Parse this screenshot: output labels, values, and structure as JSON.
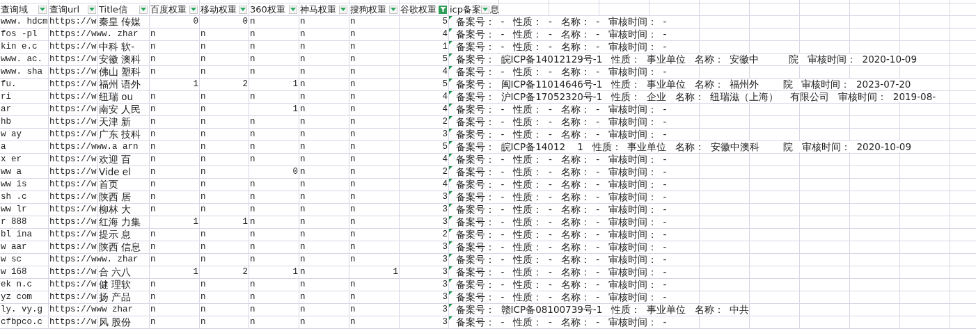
{
  "columns": [
    {
      "label": "查询域",
      "filter_active": false
    },
    {
      "label": "查询url",
      "filter_active": false
    },
    {
      "label": "Title信",
      "filter_active": false
    },
    {
      "label": "百度权重",
      "filter_active": false
    },
    {
      "label": "移动权重",
      "filter_active": false
    },
    {
      "label": "360权重",
      "filter_active": false
    },
    {
      "label": "神马权重",
      "filter_active": false
    },
    {
      "label": "搜狗权重",
      "filter_active": false
    },
    {
      "label": "谷歌权重",
      "filter_active": true
    },
    {
      "label": "icp备案",
      "label_tail": "息",
      "filter_active": false
    }
  ],
  "rows": [
    {
      "domain": "www. hdcm",
      "url": "https://w",
      "title": "秦皇 传媒",
      "baidu": "0",
      "mobile": "0",
      "r360": "n",
      "shenma": "n",
      "sogou": "n",
      "google": "5",
      "icp": "备案号：  -   性质：  -   名称：  -   审核时间：  -",
      "error_flag": true
    },
    {
      "domain": "fos -pl",
      "url": "https://www. zhar",
      "baidu": "n",
      "mobile": "n",
      "r360": "n",
      "shenma": "n",
      "sogou": "n",
      "google": "4",
      "icp": "备案号：  -   性质：  -   名称：  -   审核时间：  -",
      "error_flag": true
    },
    {
      "domain": "kin e.c",
      "url": "https://w",
      "title": "中科 软-",
      "baidu": "n",
      "mobile": "n",
      "r360": "n",
      "shenma": "n",
      "sogou": "n",
      "google": "1",
      "icp": "备案号：  -   性质：  -   名称：  -   审核时间：  -",
      "error_flag": true
    },
    {
      "domain": "www. ac.",
      "url": "https://w",
      "title": "安徽 澳科",
      "baidu": "n",
      "mobile": "n",
      "r360": "n",
      "shenma": "n",
      "sogou": "n",
      "google": "5",
      "icp": "备案号：  皖ICP备14012129号-1   性质：  事业单位   名称：  安徽中          院   审核时间：  2020-10-09",
      "error_flag": true
    },
    {
      "domain": "www. sha",
      "url": "https://w",
      "title": "佛山 塑科",
      "baidu": "n",
      "mobile": "n",
      "r360": "n",
      "shenma": "n",
      "sogou": "n",
      "google": "4",
      "icp": "备案号：  -   性质：  -   名称：  -   审核时间：  -",
      "error_flag": true
    },
    {
      "domain": "fu.",
      "url": "https://w",
      "title": "福州 语外",
      "baidu": "1",
      "mobile": "2",
      "r360": "1",
      "shenma": "n",
      "sogou": "n",
      "google": "5",
      "icp": "备案号：  闽ICP备11014646号-1   性质：  事业单位   名称：  福州外        院   审核时间：  2023-07-20",
      "error_flag": true
    },
    {
      "domain": "ri",
      "url": "https://w",
      "title": "纽瑞 ou",
      "baidu": "n",
      "mobile": "n",
      "r360": "n",
      "shenma": "n",
      "sogou": "n",
      "google": "4",
      "icp": "备案号：  沪ICP备17052320号-1   性质：  企业   名称：  纽瑞滋（上海）    有限公司   审核时间：  2019-08-",
      "error_flag": true
    },
    {
      "domain": "ar",
      "url": "https://w",
      "title": "南安 人民",
      "baidu": "n",
      "mobile": "n",
      "r360": "1",
      "shenma": "n",
      "sogou": "n",
      "google": "4",
      "icp": "备案号：  -   性质：  -   名称：  -   审核时间：  -",
      "error_flag": true
    },
    {
      "domain": "hb",
      "url": "https://w",
      "title": "天津 新",
      "baidu": "n",
      "mobile": "n",
      "r360": "n",
      "shenma": "n",
      "sogou": "n",
      "google": "2",
      "icp": "备案号：  -   性质：  -   名称：  -   审核时间：  -",
      "error_flag": true
    },
    {
      "domain": "w ay",
      "url": "https://w",
      "title": "广东 技科",
      "baidu": "n",
      "mobile": "n",
      "r360": "n",
      "shenma": "n",
      "sogou": "n",
      "google": "3",
      "icp": "备案号：  -   性质：  -   名称：  -   审核时间：  -",
      "error_flag": true
    },
    {
      "domain": "a",
      "url": "https://www.a arn",
      "baidu": "n",
      "mobile": "n",
      "r360": "n",
      "shenma": "n",
      "sogou": "n",
      "google": "5",
      "icp": "备案号：  皖ICP备14012    1   性质：  事业单位   名称：  安徽中澳科        院   审核时间：  2020-10-09",
      "error_flag": true
    },
    {
      "domain": "x er",
      "url": "https://w",
      "title": "欢迎 百",
      "baidu": "n",
      "mobile": "n",
      "r360": "n",
      "shenma": "n",
      "sogou": "n",
      "google": "4",
      "icp": "备案号：  -   性质：  -   名称：  -   审核时间：  -",
      "error_flag": true
    },
    {
      "domain": "ww a",
      "url": "https://w",
      "title": "Vide el",
      "baidu": "n",
      "mobile": "n",
      "r360": "0",
      "shenma": "n",
      "sogou": "n",
      "google": "2",
      "icp": "备案号：  -   性质：  -   名称：  -   审核时间：  -",
      "error_flag": true
    },
    {
      "domain": "ww is",
      "url": "https://w",
      "title": "首页",
      "baidu": "n",
      "mobile": "n",
      "r360": "n",
      "shenma": "n",
      "sogou": "n",
      "google": "4",
      "icp": "备案号：  -   性质：  -   名称：  -   审核时间：  -",
      "error_flag": true
    },
    {
      "domain": "sh .c",
      "url": "https://w",
      "title": "陕西 居",
      "baidu": "n",
      "mobile": "n",
      "r360": "n",
      "shenma": "n",
      "sogou": "n",
      "google": "3",
      "icp": "备案号：  -   性质：  -   名称：  -   审核时间：  -",
      "error_flag": true
    },
    {
      "domain": "ww lr",
      "url": "https://w",
      "title": "柳林 大",
      "baidu": "n",
      "mobile": "n",
      "r360": "n",
      "shenma": "n",
      "sogou": "n",
      "google": "3",
      "icp": "备案号：  -   性质：  -   名称：  -   审核时间：  -",
      "error_flag": true
    },
    {
      "domain": "r 888",
      "url": "https://w",
      "title": "红海 力集",
      "baidu": "1",
      "mobile": "1",
      "r360": "n",
      "shenma": "n",
      "sogou": "n",
      "google": "3",
      "icp": "备案号：  -   性质：  -   名称：  -   审核时间：  -",
      "error_flag": true
    },
    {
      "domain": "bl ina",
      "url": "https://w",
      "title": "提示 息",
      "baidu": "n",
      "mobile": "n",
      "r360": "n",
      "shenma": "n",
      "sogou": "n",
      "google": "2",
      "icp": "备案号：  -   性质：  -   名称：  -   审核时间：  -",
      "error_flag": true
    },
    {
      "domain": "w aar",
      "url": "https://w",
      "title": "陕西 信息",
      "baidu": "n",
      "mobile": "n",
      "r360": "n",
      "shenma": "n",
      "sogou": "n",
      "google": "3",
      "icp": "备案号：  -   性质：  -   名称：  -   审核时间：  -",
      "error_flag": true
    },
    {
      "domain": "w sc",
      "url": "https://www. zhar",
      "baidu": "n",
      "mobile": "n",
      "r360": "n",
      "shenma": "n",
      "sogou": "n",
      "google": "3",
      "icp": "备案号：  -   性质：  -   名称：  -   审核时间：  -",
      "error_flag": true
    },
    {
      "domain": "w 168",
      "url": "https://w",
      "title": "合 六八",
      "baidu": "1",
      "mobile": "2",
      "r360": "1",
      "shenma": "n",
      "sogou": "1",
      "google": "3",
      "icp": "备案号：  -   性质：  -   名称：  -   审核时间：  -",
      "error_flag": true
    },
    {
      "domain": "ek n.c",
      "url": "https://w",
      "title": "健 理软",
      "baidu": "n",
      "mobile": "n",
      "r360": "n",
      "shenma": "n",
      "sogou": "n",
      "google": "3",
      "icp": "备案号：  -   性质：  -   名称：  -   审核时间：  -",
      "error_flag": true
    },
    {
      "domain": "yz com",
      "url": "https://w",
      "title": "扬 产品",
      "baidu": "n",
      "mobile": "n",
      "r360": "n",
      "shenma": "n",
      "sogou": "n",
      "google": "3",
      "icp": "备案号：  -   性质：  -   名称：  -   审核时间：  -",
      "error_flag": true
    },
    {
      "domain": "ly. vy.g",
      "url": "https://www zhar",
      "baidu": "n",
      "mobile": "n",
      "r360": "n",
      "shenma": "n",
      "sogou": "n",
      "google": "3",
      "icp": "备案号：  赣ICP备08100739号-1   性质：  事业单位   名称：  中共",
      "error_flag": true
    },
    {
      "domain": "cfbpco.c",
      "url": "https://w",
      "title": "风 股份",
      "baidu": "n",
      "mobile": "n",
      "r360": "n",
      "shenma": "n",
      "sogou": "n",
      "google": "3",
      "icp": "备案号：  -   性质：  -   名称：  -   审核时间：  -",
      "error_flag": true
    }
  ]
}
